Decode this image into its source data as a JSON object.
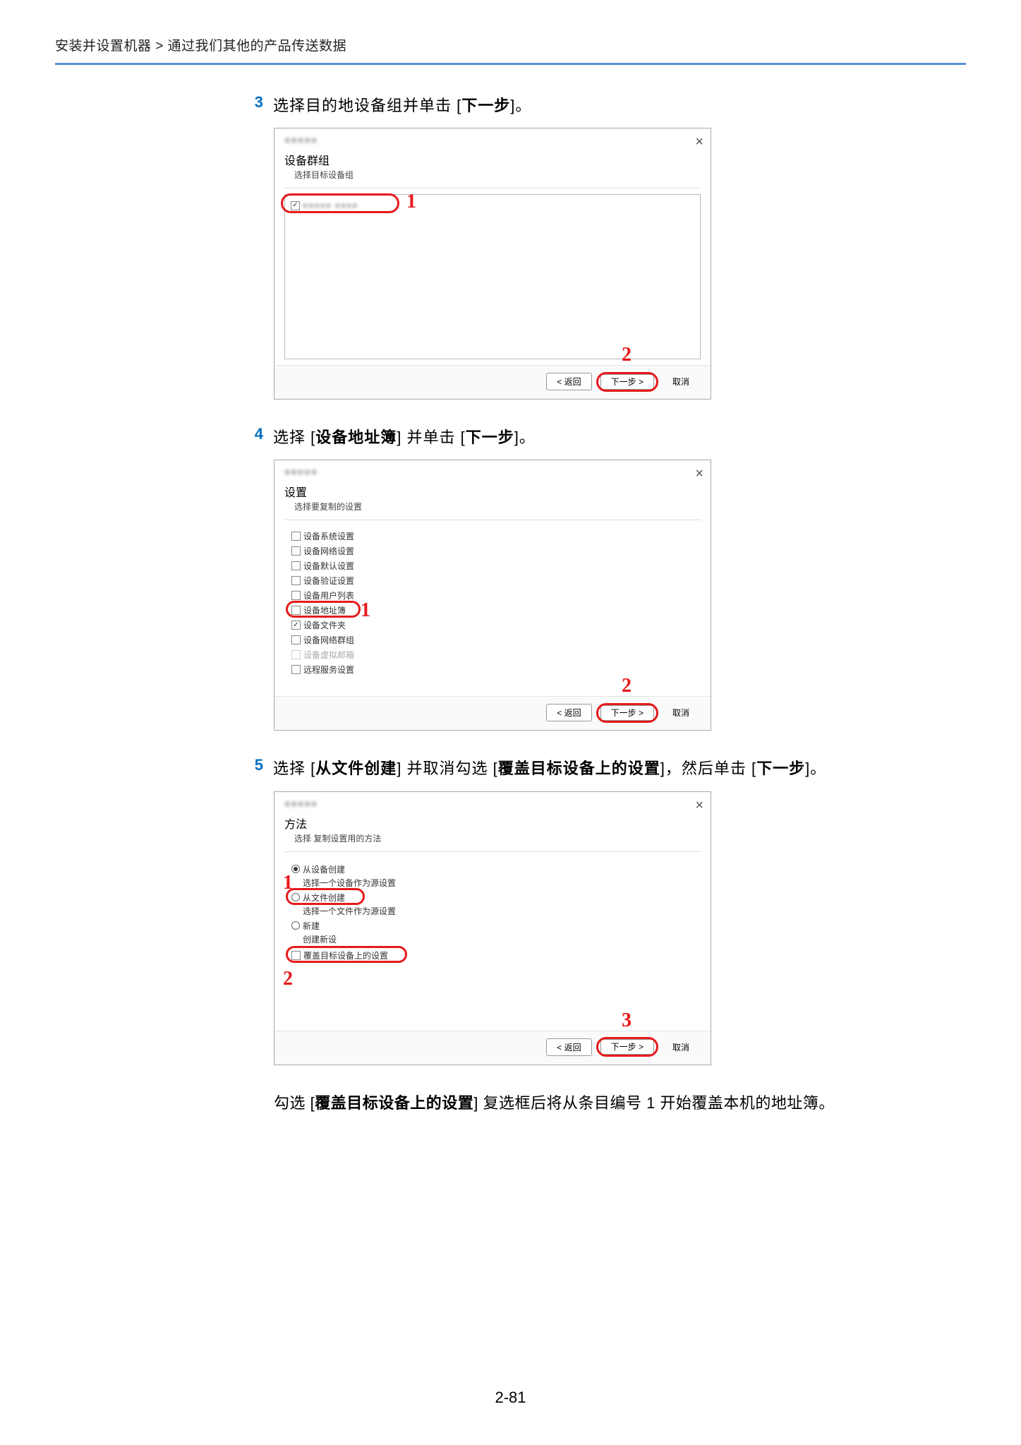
{
  "breadcrumb": "安装并设置机器 > 通过我们其他的产品传送数据",
  "steps": {
    "s3": {
      "num": "3",
      "before": "选择目的地设备组并单击 [",
      "bold": "下一步",
      "after": "]。"
    },
    "s4": {
      "num": "4",
      "t": "选择 [",
      "b1": "设备地址簿",
      "m": "] 并单击 [",
      "b2": "下一步",
      "e": "]。"
    },
    "s5": {
      "num": "5",
      "t": "选择 [",
      "b1": "从文件创建",
      "m": "] 并取消勾选 [",
      "b2": "覆盖目标设备上的设置",
      "m2": "]，然后单击 [",
      "b3": "下一步",
      "e": "]。"
    }
  },
  "fig1": {
    "title": "设备群组",
    "sub": "选择目标设备组",
    "item": "",
    "back": "< 返回",
    "next": "下一步 >",
    "cancel": "取消",
    "cap1": "1",
    "cap2": "2"
  },
  "fig2": {
    "title": "设置",
    "sub": "选择要复制的设置",
    "opts": {
      "o1": "设备系统设置",
      "o2": "设备网络设置",
      "o3": "设备默认设置",
      "o4": "设备验证设置",
      "o5": "设备用户列表",
      "o6": "设备地址簿",
      "o7": "设备文件夹",
      "o8": "设备网络群组",
      "o9": "设备虚拟邮箱",
      "o10": "远程服务设置"
    },
    "back": "< 返回",
    "next": "下一步 >",
    "cancel": "取消",
    "cap1": "1",
    "cap2": "2"
  },
  "fig3": {
    "title": "方法",
    "sub": "选择 复制设置用的方法",
    "r1": "从设备创建",
    "r1s": "选择一个设备作为源设置",
    "r2": "从文件创建",
    "r2s": "选择一个文件作为源设置",
    "r3": "新建",
    "r3s": "创建新设",
    "chk": "覆盖目标设备上的设置",
    "back": "< 返回",
    "next": "下一步 >",
    "cancel": "取消",
    "cap1": "1",
    "cap2": "2",
    "cap3": "3"
  },
  "note": {
    "t": "勾选 [",
    "b": "覆盖目标设备上的设置",
    "e": "] 复选框后将从条目编号 1 开始覆盖本机的地址簿。"
  },
  "pagenum": "2-81"
}
